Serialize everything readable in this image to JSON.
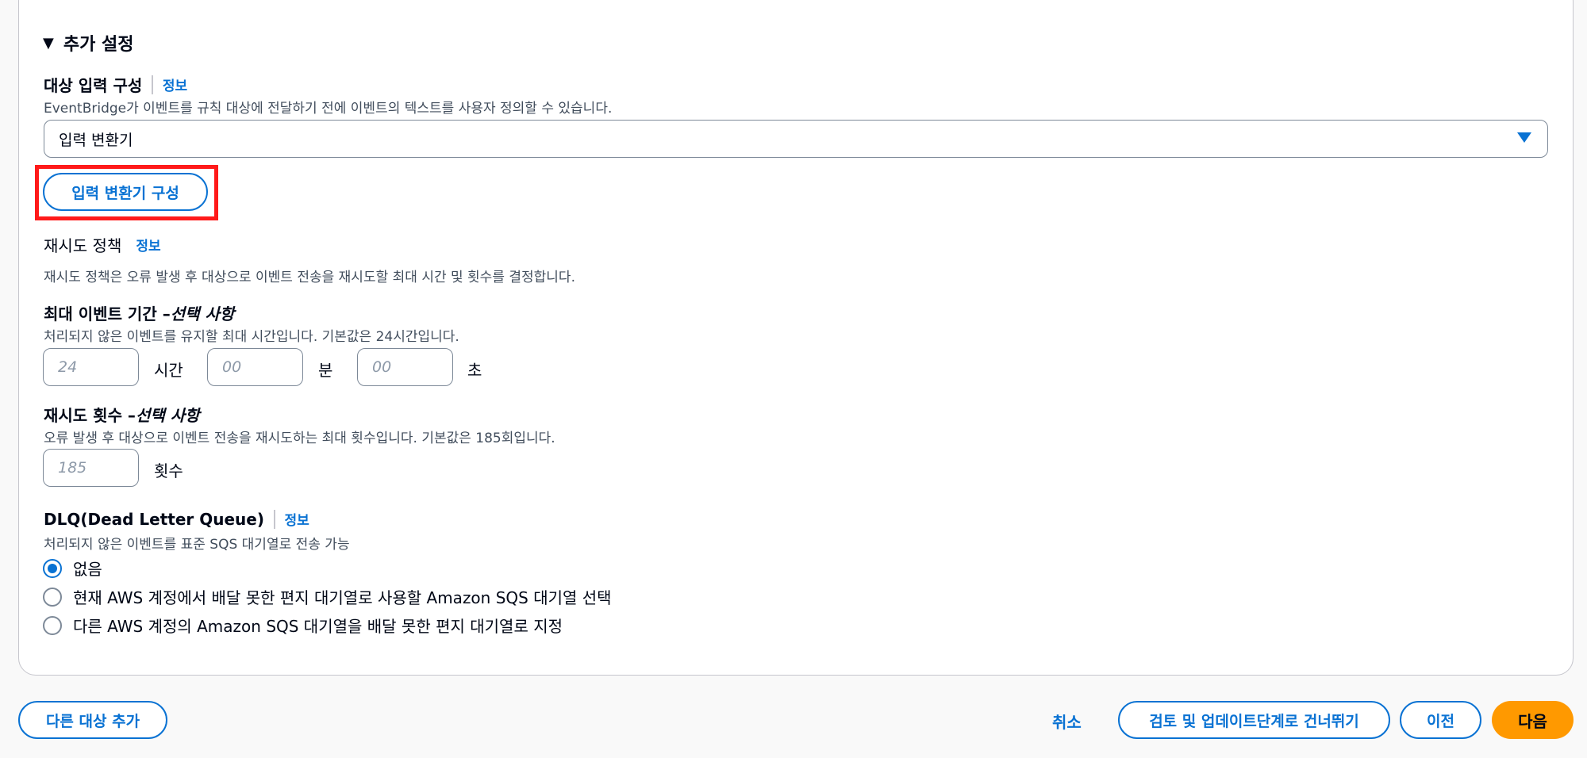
{
  "section": {
    "caret": "▼",
    "title": "추가 설정"
  },
  "target_input": {
    "label": "대상 입력 구성",
    "info": "정보",
    "description": "EventBridge가 이벤트를 규칙 대상에 전달하기 전에 이벤트의 텍스트를 사용자 정의할 수 있습니다.",
    "selected": "입력 변환기",
    "configure_button": "입력 변환기 구성"
  },
  "retry_policy": {
    "label": "재시도 정책",
    "info": "정보",
    "description": "재시도 정책은 오류 발생 후 대상으로 이벤트 전송을 재시도할 최대 시간 및 횟수를 결정합니다."
  },
  "max_event_age": {
    "label": "최대 이벤트 기간 – ",
    "optional": "선택 사항",
    "description": "처리되지 않은 이벤트를 유지할 최대 시간입니다. 기본값은 24시간입니다.",
    "hours_placeholder": "24",
    "hours_unit": "시간",
    "minutes_placeholder": "00",
    "minutes_unit": "분",
    "seconds_placeholder": "00",
    "seconds_unit": "초"
  },
  "retry_attempts": {
    "label": "재시도 횟수 – ",
    "optional": "선택 사항",
    "description": "오류 발생 후 대상으로 이벤트 전송을 재시도하는 최대 횟수입니다. 기본값은 185회입니다.",
    "placeholder": "185",
    "unit": "횟수"
  },
  "dlq": {
    "label": "DLQ(Dead Letter Queue)",
    "info": "정보",
    "description": "처리되지 않은 이벤트를 표준 SQS 대기열로 전송 가능",
    "options": [
      {
        "label": "없음",
        "checked": true
      },
      {
        "label": "현재 AWS 계정에서 배달 못한 편지 대기열로 사용할 Amazon SQS 대기열 선택",
        "checked": false
      },
      {
        "label": "다른 AWS 계정의 Amazon SQS 대기열을 배달 못한 편지 대기열로 지정",
        "checked": false
      }
    ]
  },
  "footer": {
    "add_target": "다른 대상 추가",
    "cancel": "취소",
    "skip": "검토 및 업데이트단계로 건너뛰기",
    "previous": "이전",
    "next": "다음"
  },
  "colors": {
    "accent": "#0972d3",
    "primary": "#ff9900",
    "highlight": "#ff1a1a"
  }
}
